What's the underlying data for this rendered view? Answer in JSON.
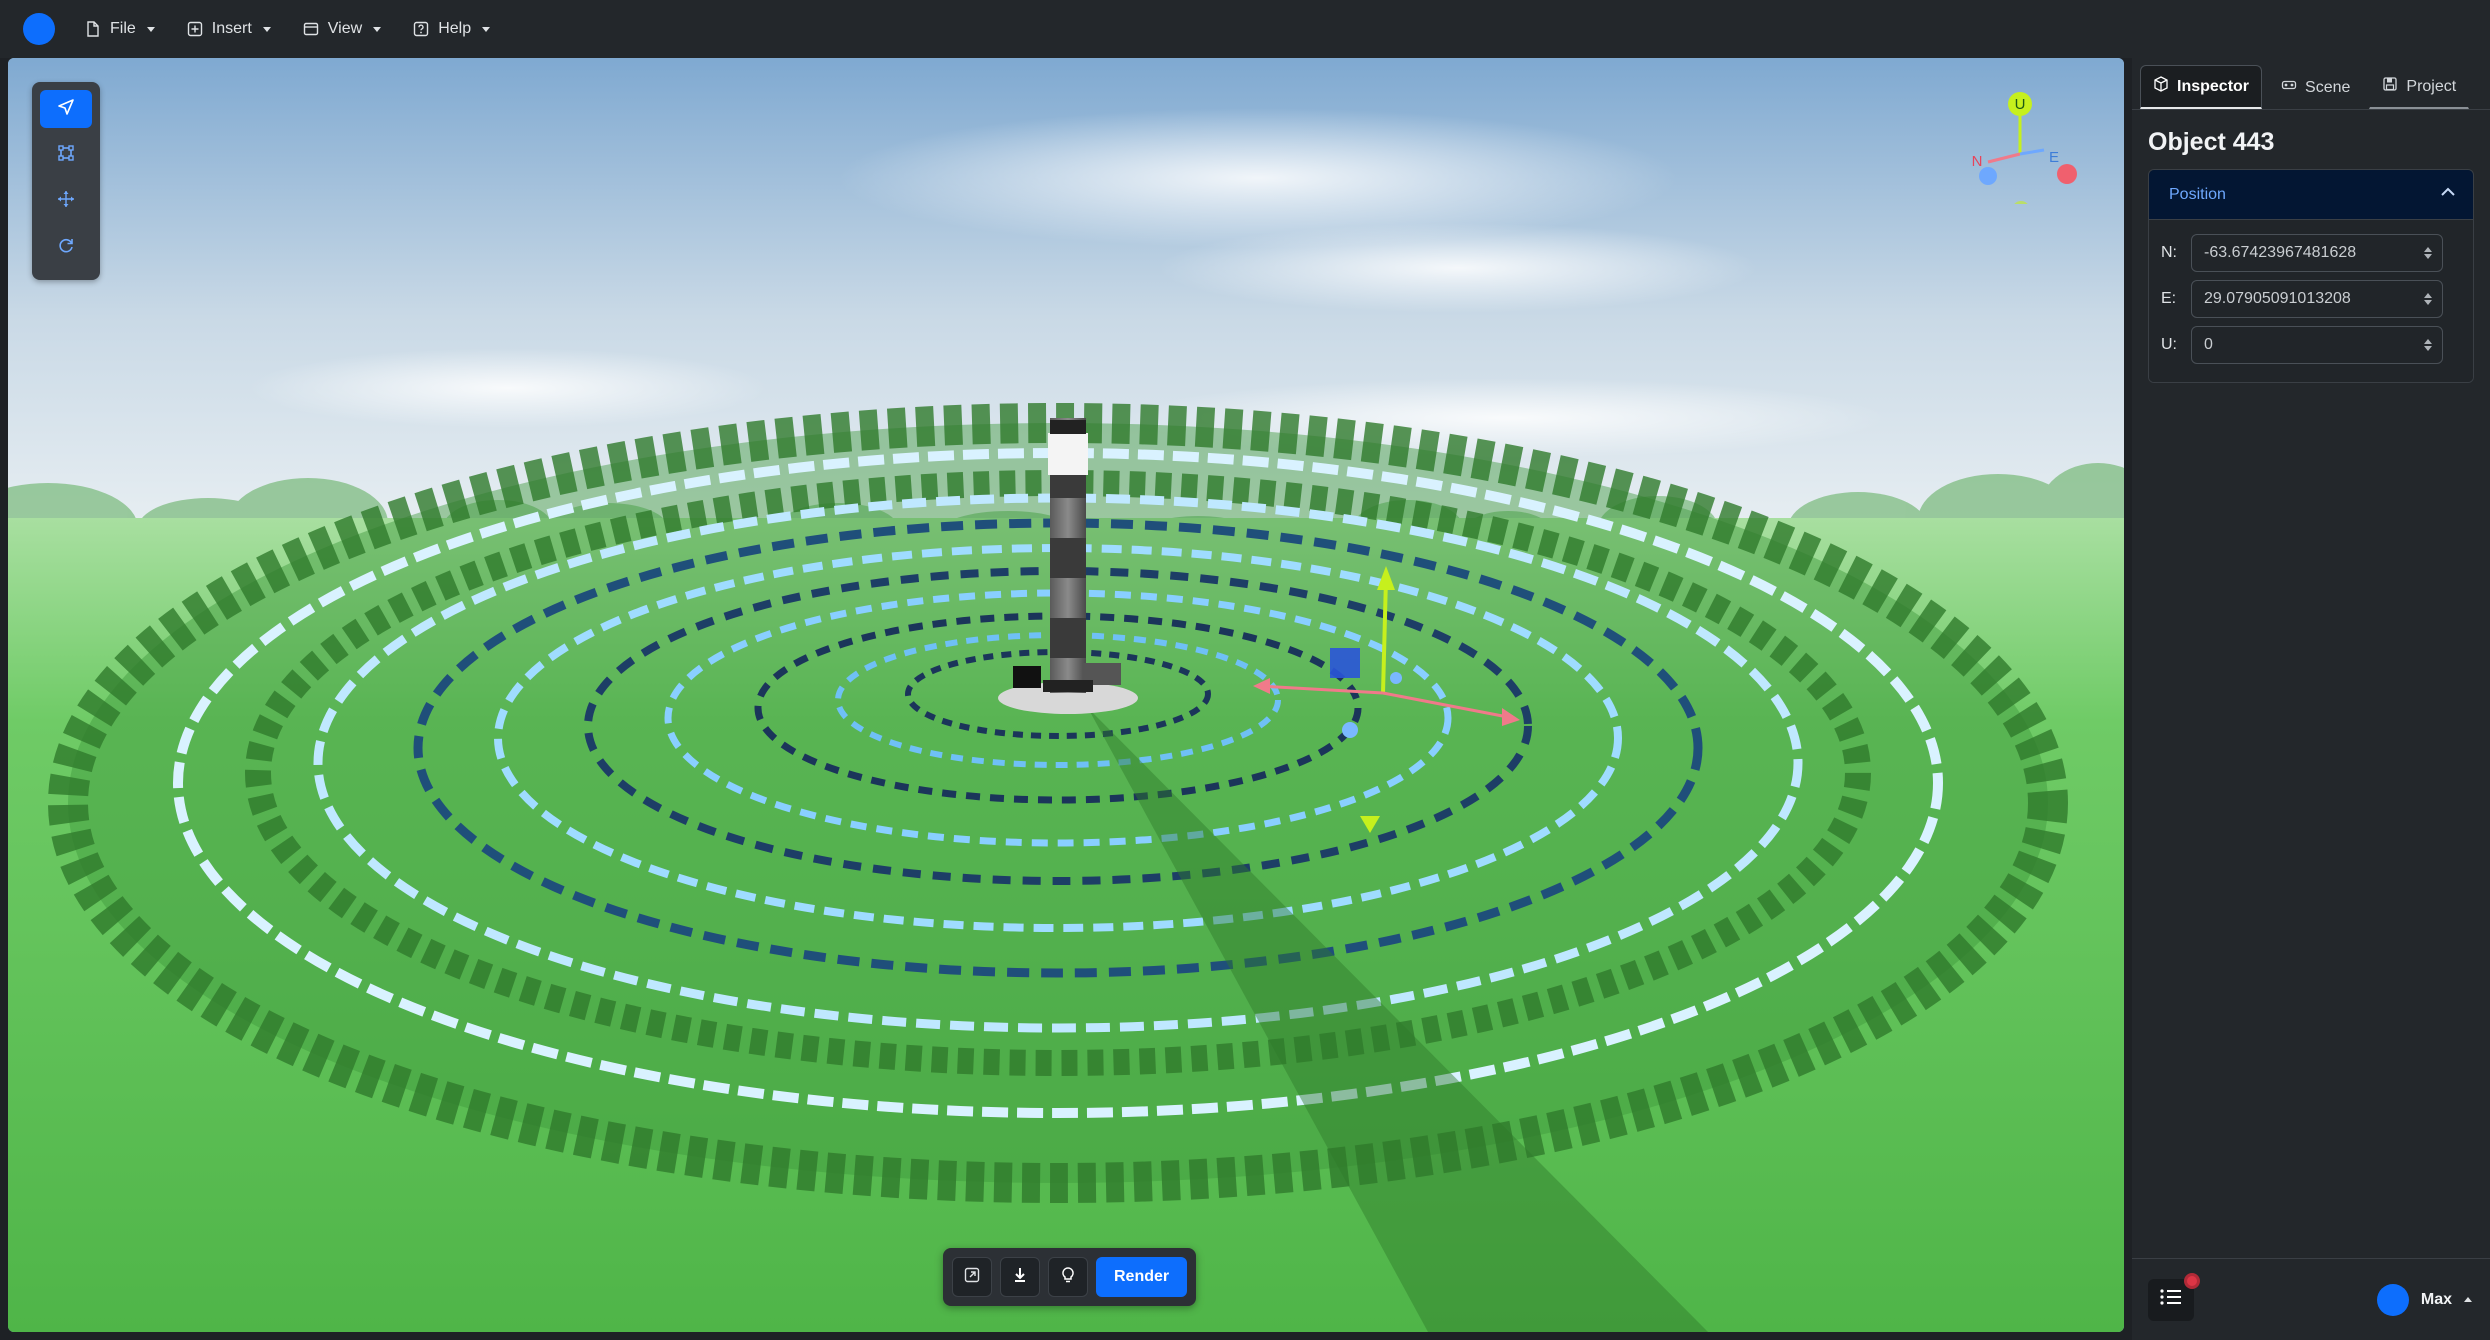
{
  "menubar": {
    "items": [
      {
        "label": "File",
        "icon": "file-icon"
      },
      {
        "label": "Insert",
        "icon": "plus-square-icon"
      },
      {
        "label": "View",
        "icon": "window-icon"
      },
      {
        "label": "Help",
        "icon": "question-square-icon"
      }
    ]
  },
  "viewport": {
    "tools": [
      "select-pointer-icon",
      "bounding-box-icon",
      "move-arrows-icon",
      "rotate-icon"
    ],
    "compass": {
      "north": "N",
      "east": "E",
      "up": "U"
    },
    "bottom_toolbar": {
      "icons": [
        "export-icon",
        "download-icon",
        "lightbulb-icon"
      ],
      "render_label": "Render"
    },
    "colors": {
      "accent": "#0d6efd",
      "sky": "#8fb6d9",
      "ground": "#5cbf55"
    }
  },
  "inspector": {
    "tabs": [
      {
        "label": "Inspector",
        "icon": "box-icon",
        "active": true
      },
      {
        "label": "Scene",
        "icon": "vr-headset-icon",
        "active": false
      },
      {
        "label": "Project",
        "icon": "save-icon",
        "active": false
      }
    ],
    "object_title": "Object 443",
    "section_label": "Position",
    "fields": [
      {
        "label": "N:",
        "value": "-63.67423967481628"
      },
      {
        "label": "E:",
        "value": "29.07905091013208"
      },
      {
        "label": "U:",
        "value": "0"
      }
    ]
  },
  "footer": {
    "user_name": "Max"
  }
}
